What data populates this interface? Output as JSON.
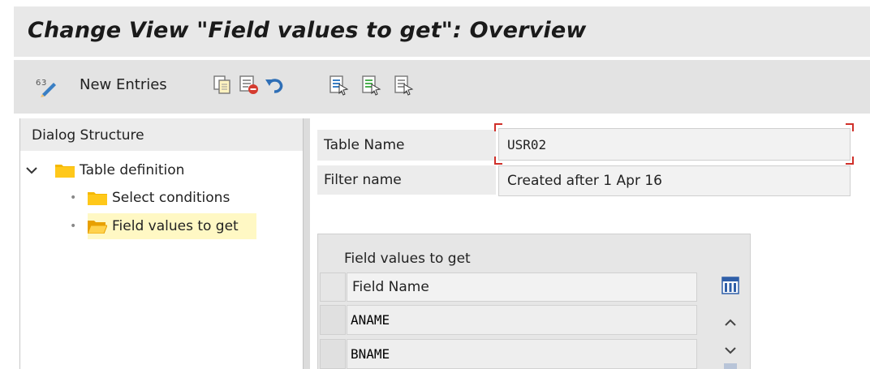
{
  "title": "Change View \"Field values to get\": Overview",
  "toolbar": {
    "new_entries_label": "New Entries",
    "icons": [
      "display-change-icon",
      "copy-icon",
      "delete-icon",
      "undo-icon",
      "select-all-icon",
      "select-block-icon",
      "deselect-all-icon"
    ]
  },
  "dialog_structure": {
    "header": "Dialog Structure",
    "items": [
      {
        "label": "Table definition",
        "level": 0,
        "expanded": true,
        "selected": false
      },
      {
        "label": "Select conditions",
        "level": 1,
        "selected": false
      },
      {
        "label": "Field values to get",
        "level": 1,
        "selected": true
      }
    ]
  },
  "fields": {
    "table_name_label": "Table Name",
    "table_name_value": "USR02",
    "filter_name_label": "Filter name",
    "filter_name_value": "Created after 1 Apr 16"
  },
  "table_control": {
    "title": "Field values to get",
    "column_header": "Field Name",
    "rows": [
      "ANAME",
      "BNAME"
    ]
  },
  "colors": {
    "folder": "#f5b800",
    "selected_row": "#fff8c4",
    "focus_marker": "#d0302a"
  }
}
